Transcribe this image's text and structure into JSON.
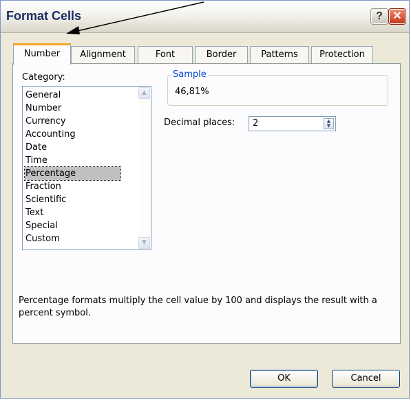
{
  "window": {
    "title": "Format Cells",
    "help_glyph": "?",
    "close_glyph": "✕"
  },
  "tabs": [
    {
      "label": "Number",
      "active": true
    },
    {
      "label": "Alignment"
    },
    {
      "label": "Font"
    },
    {
      "label": "Border"
    },
    {
      "label": "Patterns"
    },
    {
      "label": "Protection"
    }
  ],
  "category": {
    "label": "Category:",
    "items": [
      "General",
      "Number",
      "Currency",
      "Accounting",
      "Date",
      "Time",
      "Percentage",
      "Fraction",
      "Scientific",
      "Text",
      "Special",
      "Custom"
    ],
    "selected": "Percentage"
  },
  "sample": {
    "legend": "Sample",
    "value": "46,81%"
  },
  "decimal_places": {
    "label": "Decimal places:",
    "value": "2"
  },
  "description": "Percentage formats multiply the cell value by 100 and displays the result with a percent symbol.",
  "buttons": {
    "ok": "OK",
    "cancel": "Cancel"
  },
  "colors": {
    "title_text": "#1a2c66",
    "active_tab_accent": "#f5a623",
    "sample_legend": "#0046d5",
    "selected_item_bg": "#c0c0c0"
  }
}
